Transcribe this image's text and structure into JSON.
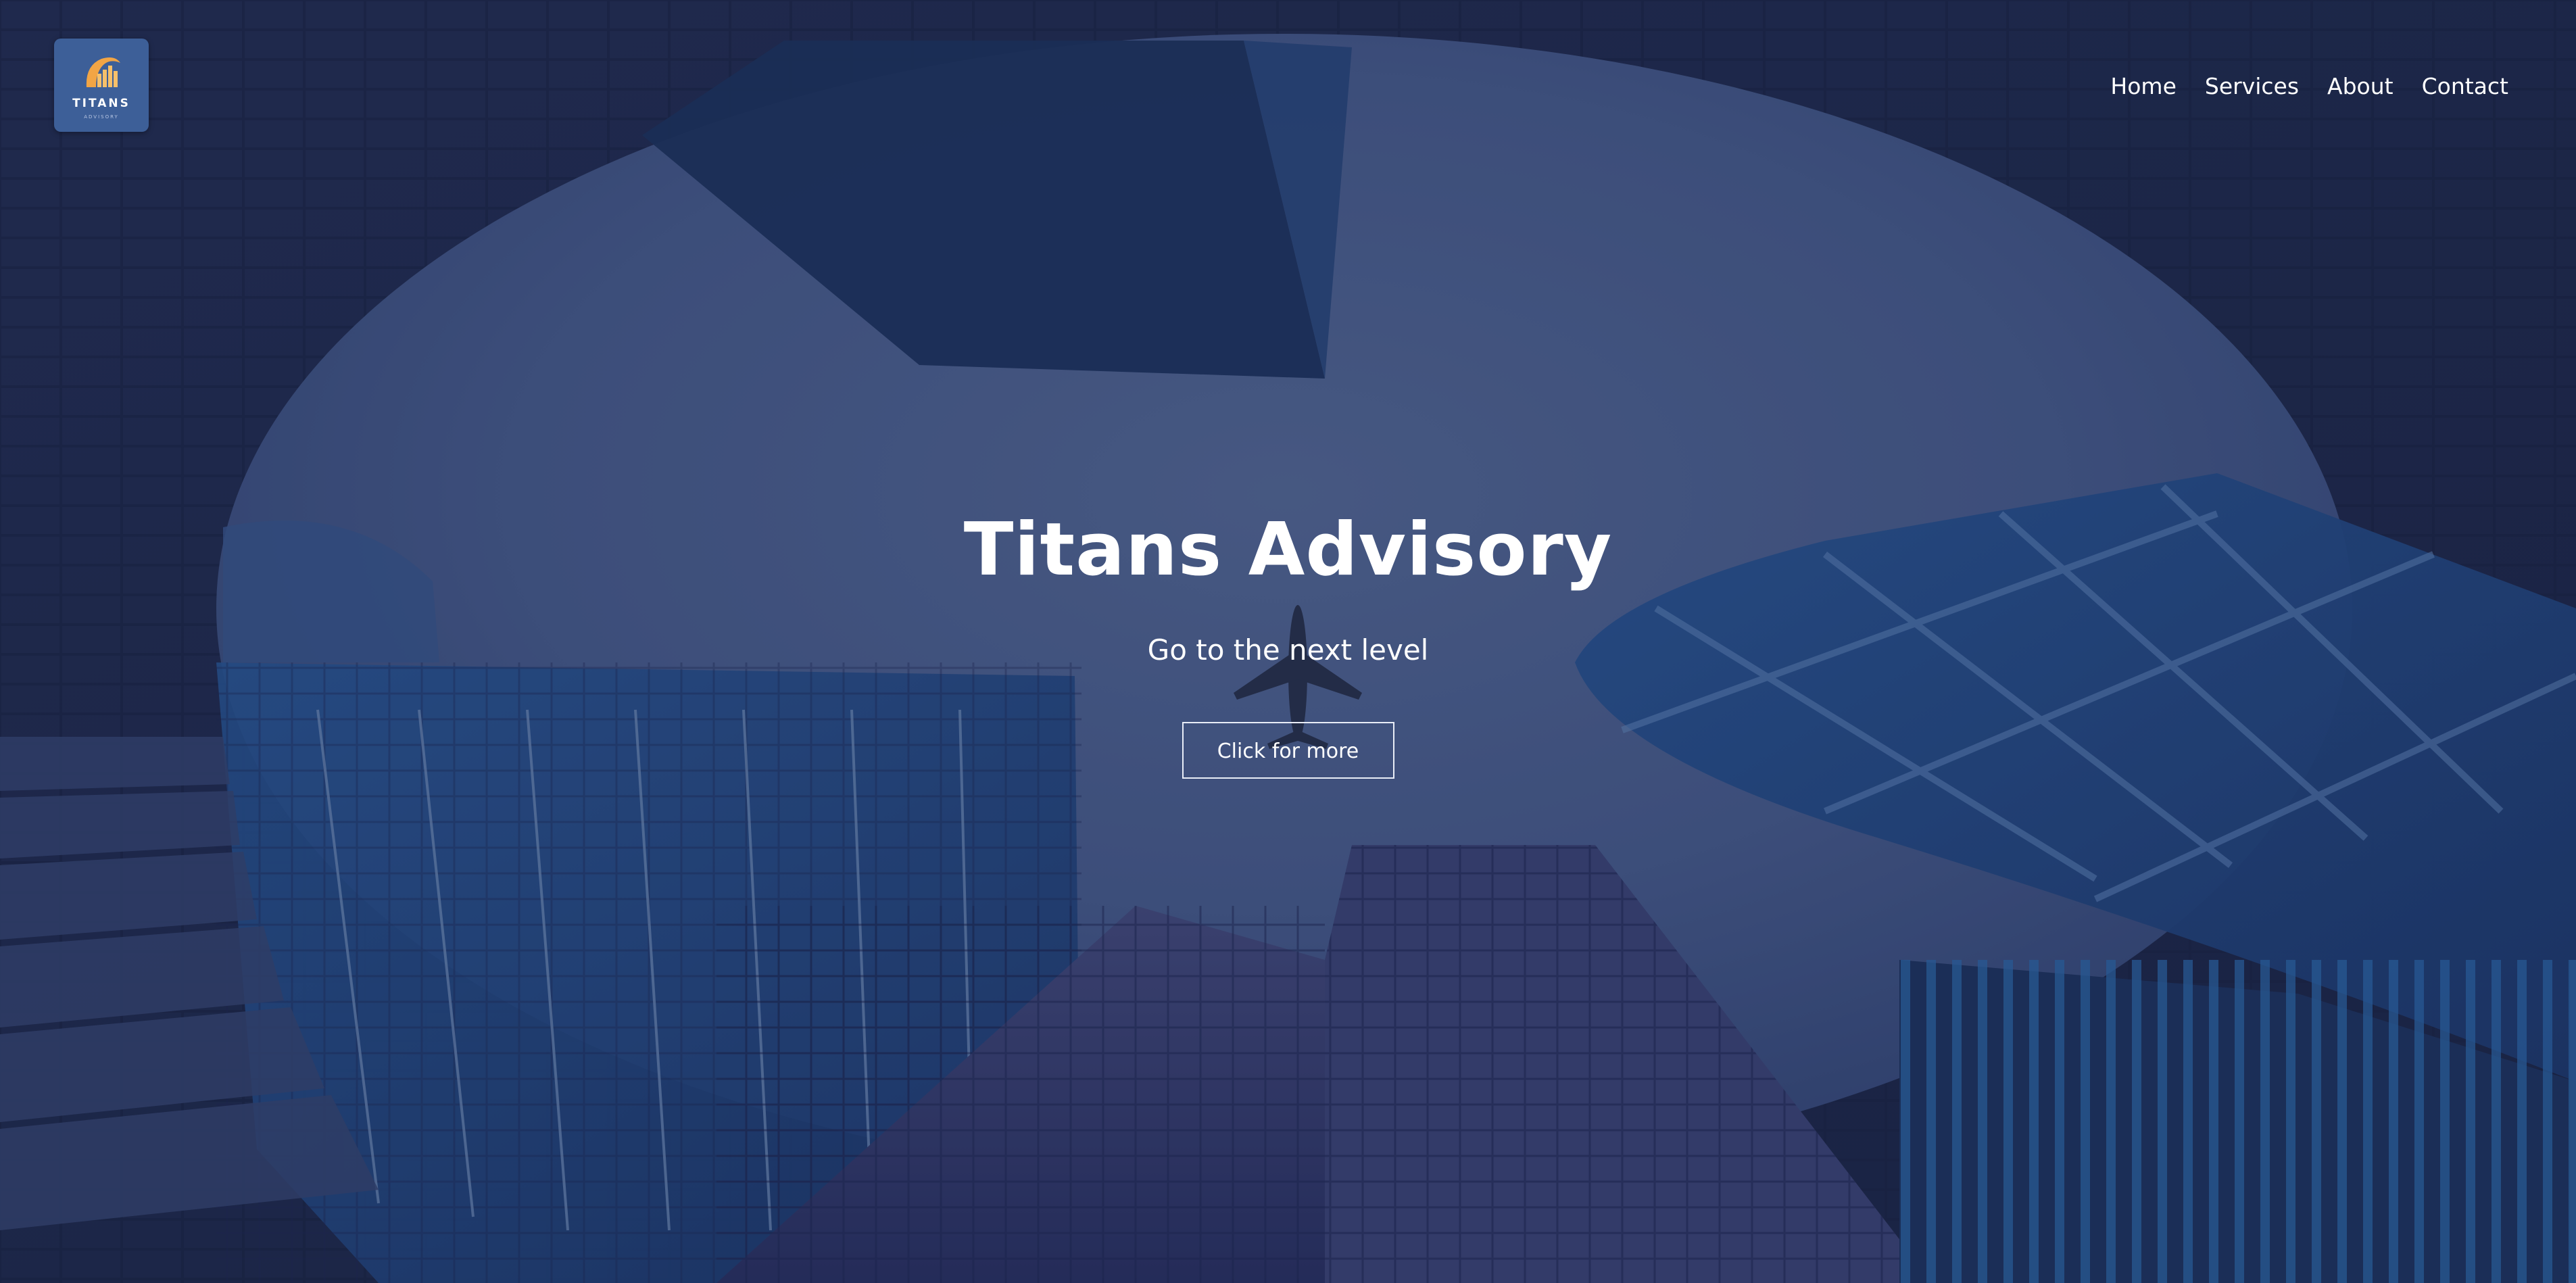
{
  "brand": {
    "logo_text": "TITANS",
    "logo_subtext": "ADVISORY"
  },
  "nav": {
    "items": [
      "Home",
      "Services",
      "About",
      "Contact"
    ]
  },
  "hero": {
    "title": "Titans Advisory",
    "subtitle": "Go to the next level",
    "cta_label": "Click for more"
  },
  "colors": {
    "overlay": "#1b2a55",
    "logo_bg": "#3d5f98",
    "logo_accent": "#f2a545",
    "text": "#ffffff"
  }
}
